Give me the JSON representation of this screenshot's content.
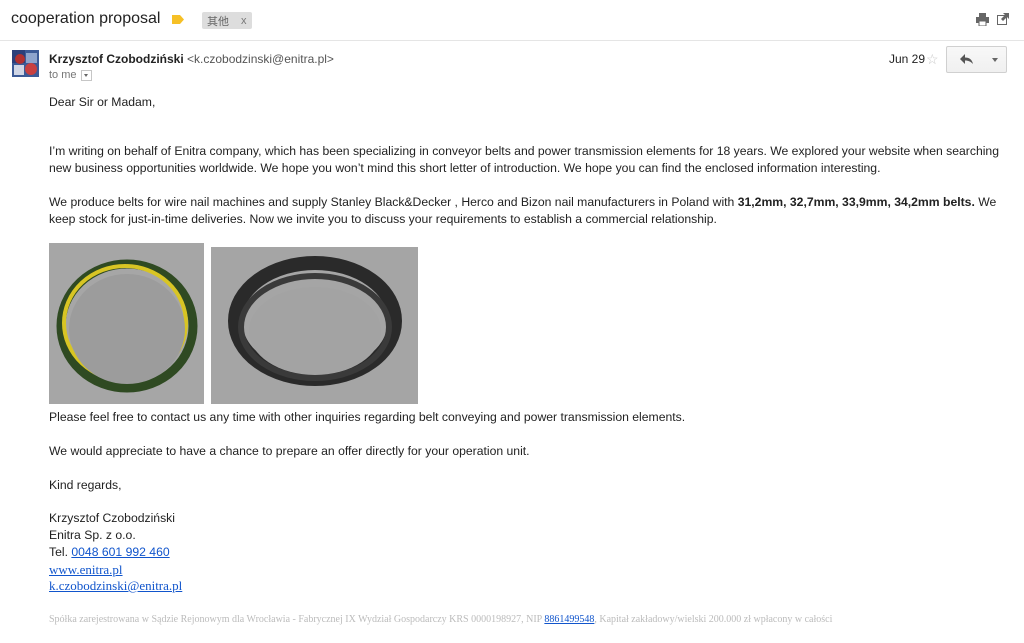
{
  "header": {
    "subject": "cooperation proposal",
    "label_chip": "其他",
    "label_remove": "x"
  },
  "message": {
    "sender_name": "Krzysztof Czobodziński",
    "sender_email": "<k.czobodzinski@enitra.pl>",
    "recipient": "to me",
    "date": "Jun 29",
    "greeting": "Dear Sir or Madam,",
    "para1": "I’m writing on behalf of Enitra company, which has been specializing in conveyor belts and power transmission elements for 18 years. We explored your website when searching new business opportunities worldwide. We hope you won’t mind this short letter of introduction. We hope you can find the enclosed information interesting.",
    "para2_start": "We produce belts for wire nail machines and supply Stanley Black&Decker , Herco and Bizon nail manufacturers in Poland with ",
    "para2_bold": "31,2mm, 32,7mm, 33,9mm, 34,2mm belts.",
    "para2_end": " We keep stock for just-in-time deliveries. Now we invite you to discuss your requirements to  establish a commercial  relationship.",
    "para3": "Please feel free to contact us any time with other inquiries regarding belt conveying and power transmission elements.",
    "para4": "We would appreciate to have a chance to prepare an offer directly for your operation unit.",
    "closing": "Kind regards,"
  },
  "signature": {
    "name": "Krzysztof Czobodziński",
    "company": "Enitra Sp. z o.o.",
    "tel_label": "Tel. ",
    "tel": "0048 601 992 460",
    "website": "www.enitra.pl",
    "email": "k.czobodzinski@enitra.pl"
  },
  "footer": {
    "text_start": "Spółka zarejestrowana w Sądzie Rejonowym dla Wrocławia - Fabrycznej IX Wydział Gospodarczy KRS 0000198927, NIP ",
    "nip": "8861499548",
    "text_end": ", Kapitał zakładowy/wielski 200.000 zł wpłacony w całości"
  },
  "colors": {
    "link": "#1155cc",
    "label_icon": "#f6c026",
    "footer_text": "#bbbbbb"
  },
  "icons": [
    "label-tag-icon",
    "print-icon",
    "new-window-icon",
    "star-icon",
    "reply-icon",
    "more-options-icon",
    "dropdown-icon"
  ]
}
